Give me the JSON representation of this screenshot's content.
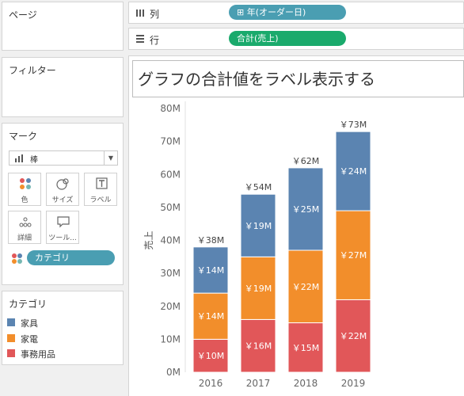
{
  "pages": {
    "title": "ページ"
  },
  "filters": {
    "title": "フィルター"
  },
  "marks": {
    "title": "マーク",
    "mark_type": "棒",
    "buttons": [
      {
        "label": "色",
        "icon": "color-icon"
      },
      {
        "label": "サイズ",
        "icon": "size-icon"
      },
      {
        "label": "ラベル",
        "icon": "label-icon"
      },
      {
        "label": "詳細",
        "icon": "detail-icon"
      },
      {
        "label": "ツール...",
        "icon": "tooltip-icon"
      }
    ],
    "color_pill": "カテゴリ"
  },
  "legend": {
    "title": "カテゴリ",
    "items": [
      {
        "label": "家具",
        "color": "#5b84b1"
      },
      {
        "label": "家電",
        "color": "#f28e2b"
      },
      {
        "label": "事務用品",
        "color": "#e15759"
      }
    ]
  },
  "shelves": {
    "columns_label": "列",
    "columns_pill": "⊞ 年(オーダー日)",
    "rows_label": "行",
    "rows_pill": "合計(売上)"
  },
  "view": {
    "title": "グラフの合計値をラベル表示する"
  },
  "chart_data": {
    "type": "bar",
    "stacked": true,
    "categories": [
      "2016",
      "2017",
      "2018",
      "2019"
    ],
    "series": [
      {
        "name": "事務用品",
        "color": "#e15759",
        "values": [
          10,
          16,
          15,
          22
        ],
        "labels": [
          "￥10M",
          "￥16M",
          "￥15M",
          "￥22M"
        ]
      },
      {
        "name": "家電",
        "color": "#f28e2b",
        "values": [
          14,
          19,
          22,
          27
        ],
        "labels": [
          "￥14M",
          "￥19M",
          "￥22M",
          "￥27M"
        ]
      },
      {
        "name": "家具",
        "color": "#5b84b1",
        "values": [
          14,
          19,
          25,
          24
        ],
        "labels": [
          "￥14M",
          "￥19M",
          "￥25M",
          "￥24M"
        ]
      }
    ],
    "totals": [
      "￥38M",
      "￥54M",
      "￥62M",
      "￥73M"
    ],
    "ylabel": "売上",
    "ylim": [
      0,
      80
    ],
    "yticks": [
      0,
      10,
      20,
      30,
      40,
      50,
      60,
      70,
      80
    ],
    "ytick_labels": [
      "0M",
      "10M",
      "20M",
      "30M",
      "40M",
      "50M",
      "60M",
      "70M",
      "80M"
    ],
    "grid": false
  }
}
